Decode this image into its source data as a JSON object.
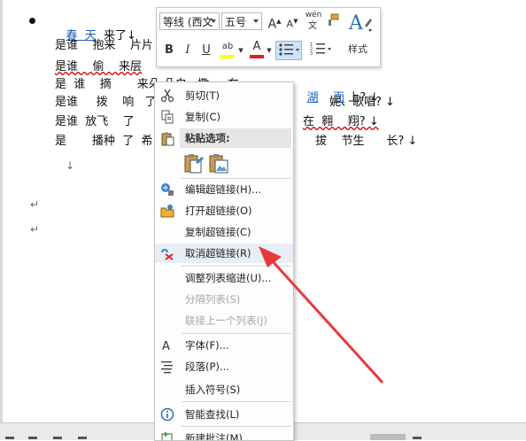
{
  "document": {
    "lines": [
      {
        "parts": [
          {
            "text": "春  天",
            "link": true
          },
          {
            "text": "  来了↓"
          }
        ]
      },
      {
        "parts": [
          {
            "text": "是谁    抱来    片片"
          }
        ]
      },
      {
        "parts": [
          {
            "text": "是谁    偷    来层"
          }
        ]
      },
      {
        "parts": [
          {
            "text": "是  谁    摘       来朵 朵白   撒     在"
          },
          {
            "text": "湖",
            "link": true
          },
          {
            "text": "    "
          },
          {
            "text": "面",
            "link": true
          },
          {
            "text": " 上? ↓"
          }
        ]
      },
      {
        "parts": [
          {
            "text": "是谁     拨    响   了"
          }
        ]
      },
      {
        "parts": [
          {
            "text": "是谁  放飞    了"
          }
        ]
      },
      {
        "parts": [
          {
            "text": "是       播种  了  希"
          }
        ]
      }
    ],
    "right_fragments": [
      {
        "text": "妮、歌唱? ↓"
      },
      {
        "text": "在  翱    翔? ↓"
      },
      {
        "text": "拔    节生      长? ↓"
      }
    ],
    "para_marks": [
      "↓",
      "↵",
      "↵"
    ]
  },
  "mini_toolbar": {
    "font_name": "等线 (西文",
    "font_size": "五号",
    "grow_font": "A",
    "shrink_font": "A",
    "phonetic": "wén",
    "bold": "B",
    "italic": "I",
    "underline": "U",
    "highlight": "ab",
    "font_color": "A",
    "styles_label": "样式"
  },
  "context_menu": {
    "items": [
      {
        "label": "剪切(T)",
        "icon": "scissors-icon",
        "enabled": true
      },
      {
        "label": "复制(C)",
        "icon": "copy-icon",
        "enabled": true
      },
      {
        "label": "粘贴选项:",
        "icon": "paste-icon",
        "enabled": true
      },
      {
        "label": "编辑超链接(H)...",
        "icon": "edit-link-icon",
        "enabled": true
      },
      {
        "label": "打开超链接(O)",
        "icon": "open-link-icon",
        "enabled": true
      },
      {
        "label": "复制超链接(C)",
        "icon": "",
        "enabled": true
      },
      {
        "label": "取消超链接(R)",
        "icon": "remove-link-icon",
        "enabled": true
      },
      {
        "label": "调整列表缩进(U)...",
        "icon": "",
        "enabled": true
      },
      {
        "label": "分隔列表(S)",
        "icon": "",
        "enabled": false
      },
      {
        "label": "联接上一个列表(J)",
        "icon": "",
        "enabled": false
      },
      {
        "label": "字体(F)...",
        "icon": "font-icon",
        "enabled": true
      },
      {
        "label": "段落(P)...",
        "icon": "paragraph-icon",
        "enabled": true
      },
      {
        "label": "插入符号(S)",
        "icon": "",
        "enabled": true
      },
      {
        "label": "智能查找(L)",
        "icon": "info-icon",
        "enabled": true
      },
      {
        "label": "新建批注(M)",
        "icon": "new-comment-icon",
        "enabled": true
      }
    ]
  },
  "colors": {
    "link": "#1a5fb4",
    "arrow": "#e8383d",
    "highlight_bar": "#ffff00",
    "font_color_bar": "#e02020"
  }
}
